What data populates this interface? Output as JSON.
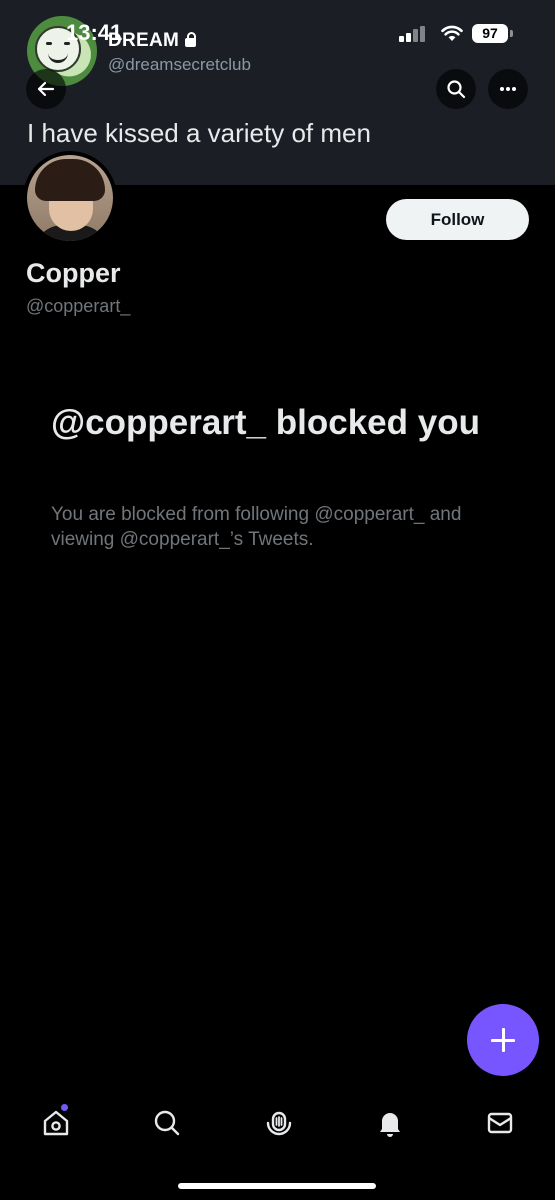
{
  "status_bar": {
    "time": "13:41",
    "battery": "97"
  },
  "banner": {
    "account_name": "DREAM",
    "account_handle": "@dreamsecretclub",
    "tweet_text": "I have kissed a variety of men"
  },
  "profile": {
    "name": "Copper",
    "handle": "@copperart_",
    "follow_label": "Follow"
  },
  "blocked": {
    "title": "@copperart_ blocked you",
    "description": "You are blocked from following @copperart_ and viewing @copperart_’s Tweets."
  },
  "tabbar": {
    "items": [
      {
        "icon": "home-icon",
        "has_notification": true
      },
      {
        "icon": "search-icon"
      },
      {
        "icon": "spaces-icon"
      },
      {
        "icon": "bell-icon"
      },
      {
        "icon": "mail-icon"
      }
    ]
  },
  "colors": {
    "accent": "#7856ff",
    "background": "#000000",
    "banner": "#1b1f25"
  }
}
